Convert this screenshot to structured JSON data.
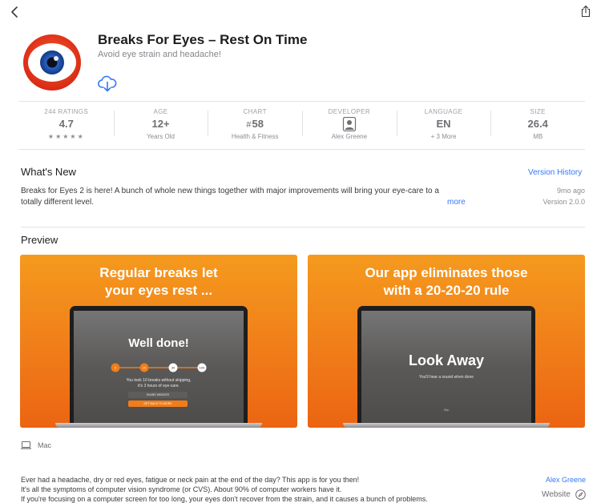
{
  "app": {
    "title": "Breaks For Eyes – Rest On Time",
    "subtitle": "Avoid eye strain and headache!"
  },
  "info": {
    "ratings": {
      "label": "244 RATINGS",
      "value": "4.7",
      "stars": "★★★★★"
    },
    "age": {
      "label": "AGE",
      "value": "12+",
      "sub": "Years Old"
    },
    "chart": {
      "label": "CHART",
      "hash": "#",
      "value": "58",
      "sub": "Health & Fitness"
    },
    "developer": {
      "label": "DEVELOPER",
      "sub": "Alex Greene"
    },
    "language": {
      "label": "LANGUAGE",
      "value": "EN",
      "sub": "+ 3 More"
    },
    "size": {
      "label": "SIZE",
      "value": "26.4",
      "sub": "MB"
    }
  },
  "whats_new": {
    "title": "What's New",
    "history_link": "Version History",
    "text_line1": "Breaks for Eyes 2 is here! A bunch of whole new things together with major improvements will bring your eye-care to a",
    "text_line2": "totally different level.",
    "more": "more",
    "age": "9mo ago",
    "version": "Version 2.0.0"
  },
  "preview": {
    "title": "Preview",
    "shot1": {
      "headline_line1": "Regular breaks let",
      "headline_line2": "your eyes rest ...",
      "screen_title": "Well done!",
      "steps": [
        "5",
        "15",
        "30",
        "100"
      ],
      "text_line1": "You took 10 breaks without skipping,",
      "text_line2": "it's 3 hours of eye-care.",
      "share": "SHARE WEBSITE",
      "back": "GET BACK TO WORK"
    },
    "shot2": {
      "headline_line1": "Our app eliminates those",
      "headline_line2": "with a 20-20-20 rule",
      "screen_title": "Look Away",
      "screen_sub": "You'll hear a sound when done",
      "skip": "Skip"
    }
  },
  "platform": {
    "label": "Mac"
  },
  "description": {
    "line1": "Ever had a headache, dry or red eyes, fatigue or neck pain at the end of the day? This app is for you then!",
    "line2": "It's all the symptoms of computer vision syndrome (or CVS). About 90% of computer workers have it.",
    "line3": "If you're focusing on a computer screen for too long, your eyes don't recover from the strain, and it causes a bunch of problems.",
    "developer_link": "Alex Greene",
    "website": "Website"
  },
  "colors": {
    "accent": "#3478f6",
    "orange": "#f07d19",
    "icon_red": "#e83a1c"
  }
}
